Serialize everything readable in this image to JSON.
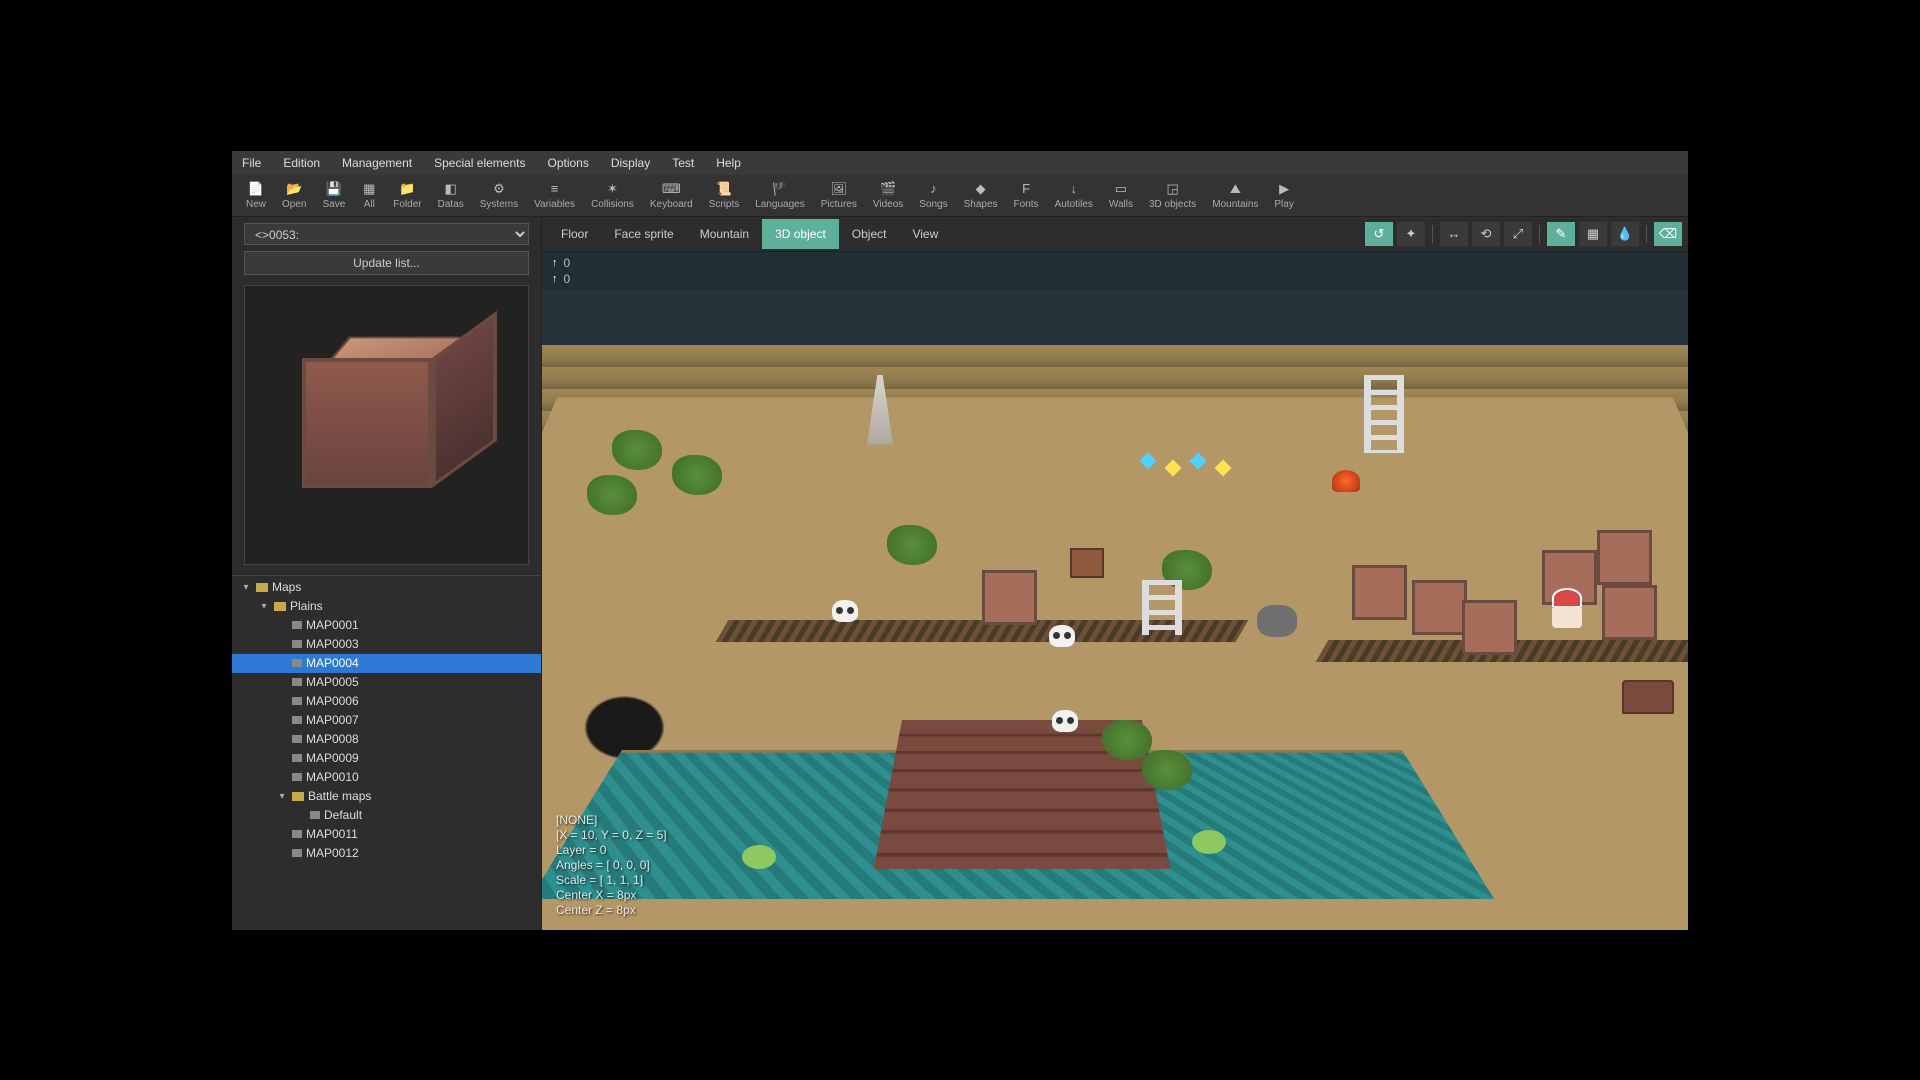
{
  "menubar": [
    "File",
    "Edition",
    "Management",
    "Special elements",
    "Options",
    "Display",
    "Test",
    "Help"
  ],
  "toolbar": [
    {
      "icon": "📄",
      "label": "New"
    },
    {
      "icon": "📂",
      "label": "Open"
    },
    {
      "icon": "💾",
      "label": "Save"
    },
    {
      "icon": "▦",
      "label": "All"
    },
    {
      "icon": "📁",
      "label": "Folder"
    },
    {
      "icon": "◧",
      "label": "Datas"
    },
    {
      "icon": "⚙",
      "label": "Systems"
    },
    {
      "icon": "≡",
      "label": "Variables"
    },
    {
      "icon": "✶",
      "label": "Collisions"
    },
    {
      "icon": "⌨",
      "label": "Keyboard"
    },
    {
      "icon": "📜",
      "label": "Scripts"
    },
    {
      "icon": "🏴",
      "label": "Languages"
    },
    {
      "icon": "🖼",
      "label": "Pictures"
    },
    {
      "icon": "🎬",
      "label": "Videos"
    },
    {
      "icon": "♪",
      "label": "Songs"
    },
    {
      "icon": "◆",
      "label": "Shapes"
    },
    {
      "icon": "F",
      "label": "Fonts"
    },
    {
      "icon": "↓",
      "label": "Autotiles"
    },
    {
      "icon": "▭",
      "label": "Walls"
    },
    {
      "icon": "◲",
      "label": "3D objects"
    },
    {
      "icon": "⛰",
      "label": "Mountains"
    },
    {
      "icon": "▶",
      "label": "Play"
    }
  ],
  "object_selector": "<>0053:",
  "update_btn": "Update list...",
  "view_tabs": [
    "Floor",
    "Face sprite",
    "Mountain",
    "3D object",
    "Object",
    "View"
  ],
  "active_view_tab": "3D object",
  "layer_rows": [
    {
      "arrow": "↑",
      "value": "0"
    },
    {
      "arrow": "↑",
      "value": "0"
    }
  ],
  "tree": [
    {
      "depth": 0,
      "exp": "▾",
      "type": "folder",
      "label": "Maps"
    },
    {
      "depth": 1,
      "exp": "▾",
      "type": "folder",
      "label": "Plains"
    },
    {
      "depth": 2,
      "exp": "",
      "type": "map",
      "label": "MAP0001"
    },
    {
      "depth": 2,
      "exp": "",
      "type": "map",
      "label": "MAP0003"
    },
    {
      "depth": 2,
      "exp": "",
      "type": "map",
      "label": "MAP0004",
      "selected": true
    },
    {
      "depth": 2,
      "exp": "",
      "type": "map",
      "label": "MAP0005"
    },
    {
      "depth": 2,
      "exp": "",
      "type": "map",
      "label": "MAP0006"
    },
    {
      "depth": 2,
      "exp": "",
      "type": "map",
      "label": "MAP0007"
    },
    {
      "depth": 2,
      "exp": "",
      "type": "map",
      "label": "MAP0008"
    },
    {
      "depth": 2,
      "exp": "",
      "type": "map",
      "label": "MAP0009"
    },
    {
      "depth": 2,
      "exp": "",
      "type": "map",
      "label": "MAP0010"
    },
    {
      "depth": 2,
      "exp": "▾",
      "type": "folder",
      "label": "Battle maps"
    },
    {
      "depth": 3,
      "exp": "",
      "type": "map",
      "label": "Default"
    },
    {
      "depth": 2,
      "exp": "",
      "type": "map",
      "label": "MAP0011"
    },
    {
      "depth": 2,
      "exp": "",
      "type": "map",
      "label": "MAP0012"
    }
  ],
  "overlay": [
    "[NONE]",
    "[X = 10, Y = 0, Z = 5]",
    "Layer = 0",
    "Angles = [ 0, 0, 0]",
    "Scale = [ 1, 1, 1]",
    "Center X = 8px",
    "Center Z = 8px"
  ],
  "right_tools": [
    {
      "icon": "↺",
      "active": true
    },
    {
      "icon": "✦",
      "active": false
    },
    {
      "sep": true
    },
    {
      "icon": "↔",
      "active": false
    },
    {
      "icon": "⟲",
      "active": false
    },
    {
      "icon": "⤢",
      "active": false
    },
    {
      "sep": true
    },
    {
      "icon": "✎",
      "active": true
    },
    {
      "icon": "▦",
      "active": false
    },
    {
      "icon": "💧",
      "active": false
    },
    {
      "sep": true
    },
    {
      "icon": "⌫",
      "active": true
    }
  ]
}
